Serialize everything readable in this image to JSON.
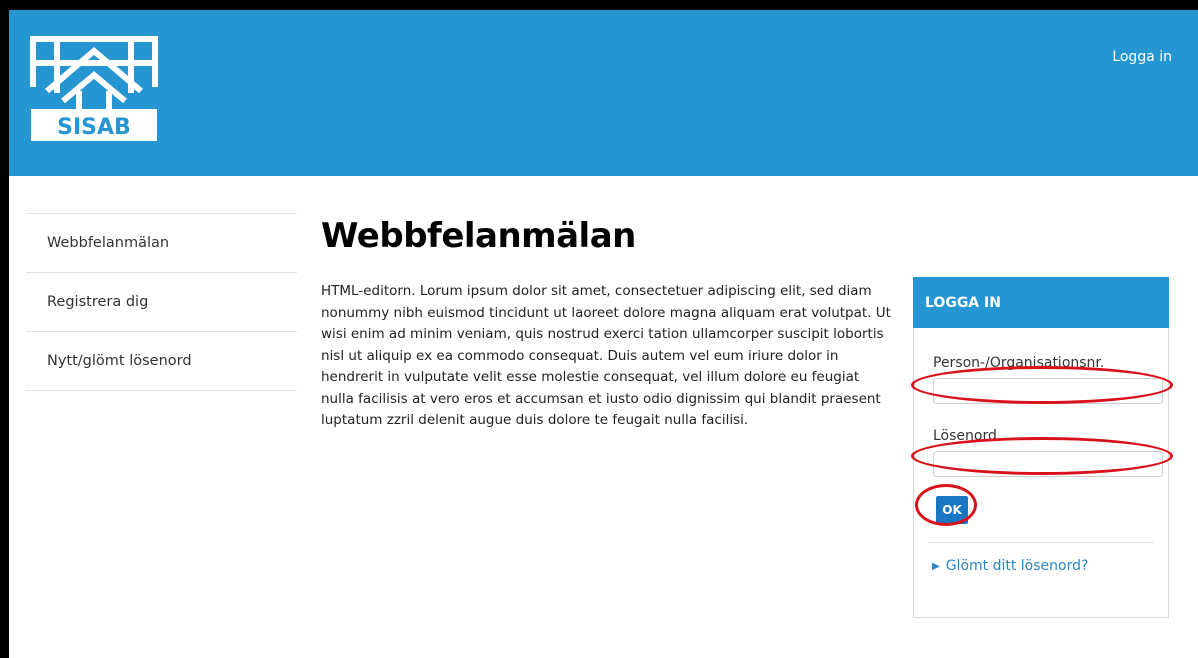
{
  "header": {
    "logo_text": "SISAB",
    "login_link": "Logga in"
  },
  "sidebar": {
    "items": [
      {
        "label": "Webbfelanmälan"
      },
      {
        "label": "Registrera dig"
      },
      {
        "label": "Nytt/glömt lösenord"
      }
    ]
  },
  "main": {
    "title": "Webbfelanmälan",
    "body": "HTML-editorn. Lorum ipsum dolor sit amet, consectetuer adipiscing elit, sed diam nonummy nibh euismod tincidunt ut laoreet dolore magna aliquam erat volutpat. Ut wisi enim ad minim veniam, quis nostrud exerci tation ullamcorper suscipit lobortis nisl ut aliquip ex ea commodo consequat. Duis autem vel eum iriure dolor in hendrerit in vulputate velit esse molestie consequat, vel illum dolore eu feugiat nulla facilisis at vero eros et accumsan et iusto odio dignissim qui blandit praesent luptatum zzril delenit augue duis dolore te feugait nulla facilisi."
  },
  "login": {
    "heading": "LOGGA IN",
    "id_label": "Person-/Organisationsnr.",
    "id_value": "",
    "password_label": "Lösenord",
    "password_value": "",
    "ok_label": "OK",
    "forgot_label": "Glömt ditt lösenord?"
  },
  "colors": {
    "header_bg": "#2596d1",
    "button_bg": "#1976c2",
    "link": "#2a86c7",
    "annotation": "#d9111a"
  }
}
